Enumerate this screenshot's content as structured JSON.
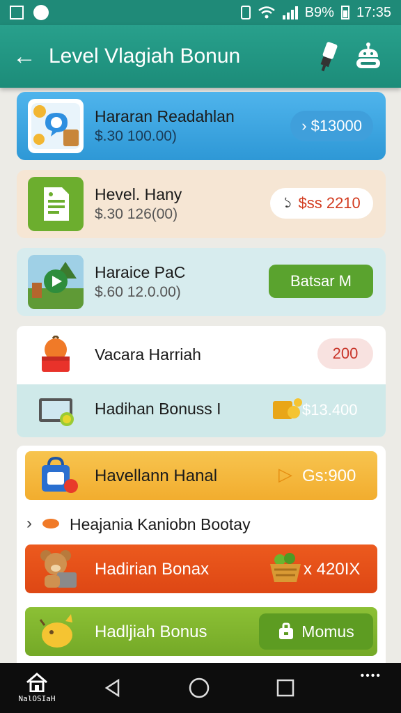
{
  "status_bar": {
    "battery_text": "B9%",
    "time": "17:35"
  },
  "app_bar": {
    "back_glyph": "←",
    "title": "Level Vlagiah Bonun"
  },
  "rows": [
    {
      "title": "Hararan Readahlan",
      "subtitle": "$.30 100.00)",
      "action": "$13000",
      "action_glyph": "›"
    },
    {
      "title": "Hevel. Hany",
      "subtitle": "$.30 126(00)",
      "action": "$ss 2210",
      "action_glyph": "১"
    },
    {
      "title": "Haraice PaC",
      "subtitle": "$.60 12.0.00)",
      "action": "Batsar M"
    },
    {
      "title": "Vacara Harriah",
      "action": "200"
    },
    {
      "title": "Hadihan Bonuss I",
      "action": "$13.400"
    },
    {
      "title": "Havellann Hanal",
      "action": "Gs:900",
      "action_glyph": "▷"
    },
    {
      "title": "Heajania Kaniobn Bootay",
      "glyph": "›"
    },
    {
      "title": "Hadirian Bonax",
      "action": "x 420IX"
    },
    {
      "title": "Hadljiah Bonus",
      "action": "Momus"
    }
  ],
  "nav": {
    "home_label": "NalOSIaH",
    "more_glyph": "••••"
  },
  "colors": {
    "header_teal": "#1f8a78",
    "blue_card": "#3aa3de",
    "green_button": "#5aa32e",
    "orange_bar": "#f5b93e",
    "red_bar": "#e44e19",
    "olive_bar": "#7fb52c"
  }
}
